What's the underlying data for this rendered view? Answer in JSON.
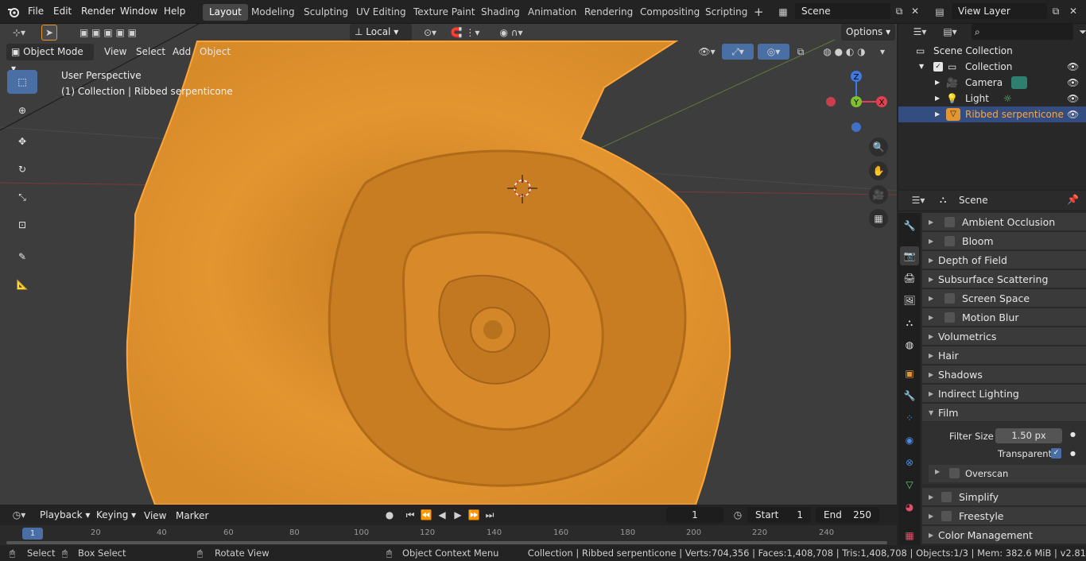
{
  "topbar": {
    "menus": [
      "File",
      "Edit",
      "Render",
      "Window",
      "Help"
    ],
    "workspaces": [
      "Layout",
      "Modeling",
      "Sculpting",
      "UV Editing",
      "Texture Paint",
      "Shading",
      "Animation",
      "Rendering",
      "Compositing",
      "Scripting"
    ],
    "active_workspace": "Layout",
    "add_tab": "+",
    "scene_field": "Scene",
    "view_layer_field": "View Layer"
  },
  "viewport": {
    "orientation": "Local",
    "options_label": "Options",
    "mode": "Object Mode",
    "menus": [
      "View",
      "Select",
      "Add",
      "Object"
    ],
    "overlay_line1": "User Perspective",
    "overlay_line2": "(1) Collection | Ribbed serpenticone",
    "gizmo": {
      "z": "Z",
      "x": "X",
      "y": "Y"
    }
  },
  "outliner": {
    "search_placeholder": "",
    "root": "Scene Collection",
    "collection": "Collection",
    "items": [
      {
        "label": "Camera",
        "icon": "camera-icon"
      },
      {
        "label": "Light",
        "icon": "light-icon"
      },
      {
        "label": "Ribbed serpenticone",
        "icon": "mesh-icon"
      }
    ]
  },
  "properties": {
    "context": "Scene",
    "panels": [
      {
        "label": "Ambient Occlusion",
        "checkbox": true,
        "expanded": false
      },
      {
        "label": "Bloom",
        "checkbox": true,
        "expanded": false
      },
      {
        "label": "Depth of Field",
        "checkbox": false,
        "expanded": false
      },
      {
        "label": "Subsurface Scattering",
        "checkbox": false,
        "expanded": false
      },
      {
        "label": "Screen Space Reflections",
        "checkbox": true,
        "expanded": false
      },
      {
        "label": "Motion Blur",
        "checkbox": true,
        "expanded": false
      },
      {
        "label": "Volumetrics",
        "checkbox": false,
        "expanded": false
      },
      {
        "label": "Hair",
        "checkbox": false,
        "expanded": false
      },
      {
        "label": "Shadows",
        "checkbox": false,
        "expanded": false
      },
      {
        "label": "Indirect Lighting",
        "checkbox": false,
        "expanded": false
      },
      {
        "label": "Film",
        "checkbox": false,
        "expanded": true
      }
    ],
    "film": {
      "filter_size_label": "Filter Size",
      "filter_size_value": "1.50 px",
      "transparent_label": "Transparent",
      "transparent_checked": true,
      "overscan_label": "Overscan"
    },
    "panels_after": [
      {
        "label": "Simplify",
        "checkbox": true
      },
      {
        "label": "Freestyle",
        "checkbox": true
      },
      {
        "label": "Color Management",
        "checkbox": false
      }
    ]
  },
  "timeline": {
    "menus": [
      "Playback",
      "Keying",
      "View",
      "Marker"
    ],
    "current_frame": "1",
    "start_label": "Start",
    "start_value": "1",
    "end_label": "End",
    "end_value": "250",
    "ruler": [
      "1",
      "20",
      "40",
      "60",
      "80",
      "100",
      "120",
      "140",
      "160",
      "180",
      "200",
      "220",
      "240"
    ]
  },
  "statusbar": {
    "select": "Select",
    "box_select": "Box Select",
    "rotate_view": "Rotate View",
    "context_menu": "Object Context Menu",
    "stats": "Collection | Ribbed serpenticone | Verts:704,356 | Faces:1,408,708 | Tris:1,408,708 | Objects:1/3 | Mem: 382.6 MiB | v2.81"
  },
  "colors": {
    "accent": "#4a6fa5",
    "selection": "#334d80",
    "object_orange": "#e0922a",
    "object_highlight": "#ffa538"
  }
}
